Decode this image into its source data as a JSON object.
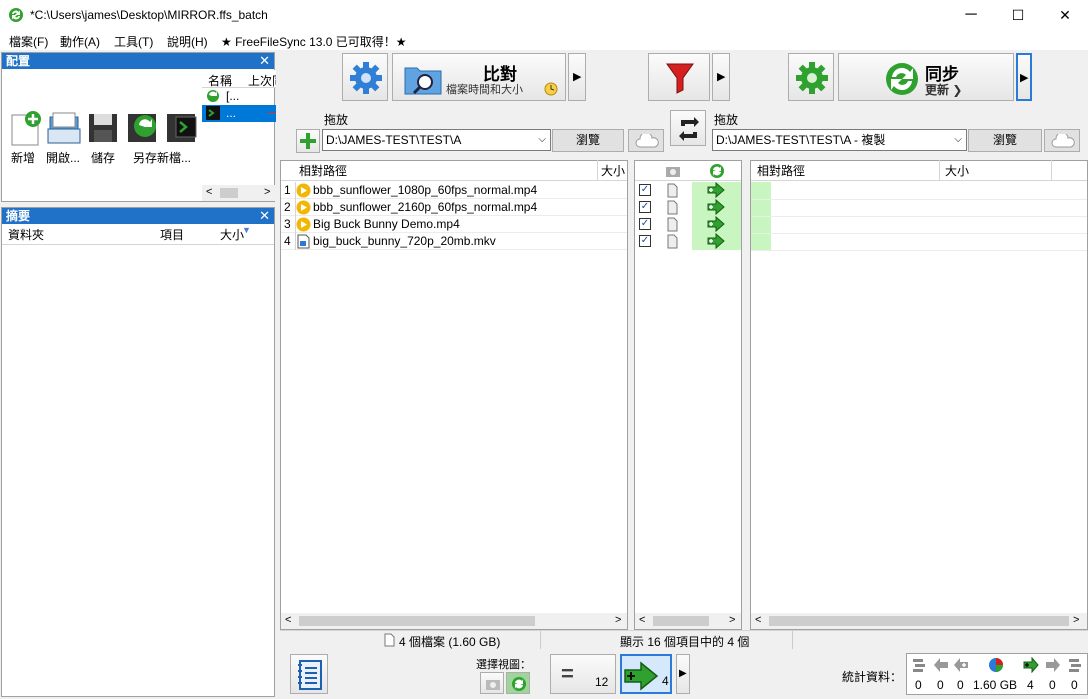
{
  "window": {
    "title": "*C:\\Users\\james\\Desktop\\MIRROR.ffs_batch",
    "minimize": "─",
    "maximize": "☐",
    "close": "✕"
  },
  "menu": {
    "items": [
      "檔案(F)",
      "動作(A)",
      "工具(T)",
      "說明(H)",
      "★ FreeFileSync 13.0 已可取得！★"
    ]
  },
  "config_panel": {
    "title": "配置",
    "close": "✕",
    "col_name": "名稱",
    "col_last": "上次同",
    "rows": [
      "[...",
      "..."
    ],
    "buttons": [
      "新增",
      "開啟...",
      "儲存",
      "另存新檔..."
    ]
  },
  "summary_panel": {
    "title": "摘要",
    "close": "✕",
    "columns": [
      "資料夾",
      "項目",
      "大小"
    ]
  },
  "toolbar": {
    "compare_label": "比對",
    "compare_sub": "檔案時間和大小",
    "sync_label": "同步",
    "sync_sub": "更新 ❯"
  },
  "left_folder": {
    "label": "拖放",
    "path": "D:\\JAMES-TEST\\TEST\\A",
    "browse": "瀏覽"
  },
  "right_folder": {
    "label": "拖放",
    "path": "D:\\JAMES-TEST\\TEST\\A - 複製",
    "browse": "瀏覽"
  },
  "left_grid": {
    "col_path": "相對路徑",
    "col_size": "大小",
    "rows": [
      {
        "n": "1",
        "name": "bbb_sunflower_1080p_60fps_normal.mp4"
      },
      {
        "n": "2",
        "name": "bbb_sunflower_2160p_60fps_normal.mp4"
      },
      {
        "n": "3",
        "name": "Big Buck Bunny Demo.mp4"
      },
      {
        "n": "4",
        "name": "big_buck_bunny_720p_20mb.mkv"
      }
    ]
  },
  "right_grid": {
    "col_path": "相對路徑",
    "col_size": "大小"
  },
  "status": {
    "left": "4 個檔案 (1.60 GB)",
    "middle": "顯示 16 個項目中的 4 個"
  },
  "bottom": {
    "view_label": "選擇視圖：",
    "equal_count": "12",
    "create_count": "4",
    "stats_label": "統計資料：",
    "stats": [
      "0",
      "0",
      "0",
      "1.60 GB",
      "4",
      "0",
      "0"
    ]
  },
  "colors": {
    "accent": "#1f72c7",
    "create_green": "#c8f5c0",
    "sync_green": "#2fa12f"
  }
}
